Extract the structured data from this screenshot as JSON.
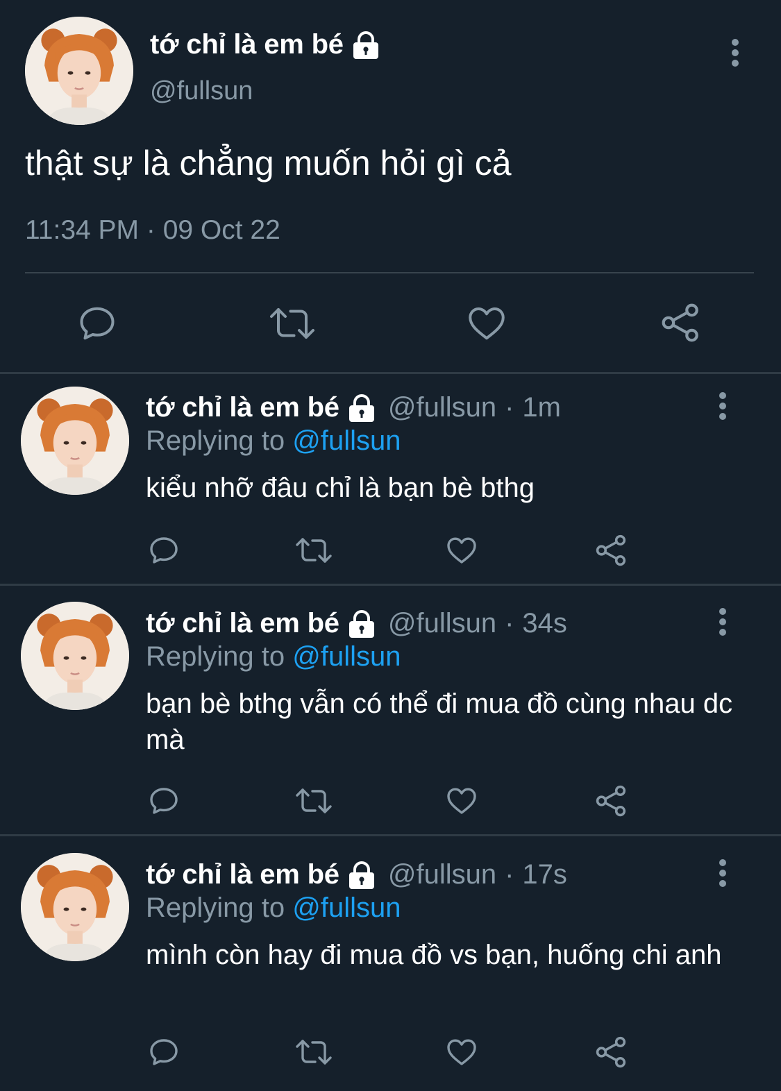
{
  "main_tweet": {
    "display_name": "tớ chỉ là em bé",
    "handle": "@fullsun",
    "text": "thật sự là chẳng muốn hỏi gì cả",
    "timestamp": "11:34 PM · 09 Oct 22",
    "icons": [
      "lock-icon",
      "more-icon",
      "reply-icon",
      "retweet-icon",
      "like-icon",
      "share-icon"
    ]
  },
  "replies": [
    {
      "display_name": "tớ chỉ là em bé",
      "handle": "@fullsun",
      "separator": "·",
      "time": "1m",
      "replying_prefix": "Replying to",
      "replying_mention": "@fullsun",
      "text": "kiểu nhỡ đâu chỉ là bạn bè bthg"
    },
    {
      "display_name": "tớ chỉ là em bé",
      "handle": "@fullsun",
      "separator": "·",
      "time": "34s",
      "replying_prefix": "Replying to",
      "replying_mention": "@fullsun",
      "text": "bạn bè bthg vẫn có thể đi mua đồ cùng nhau dc mà"
    },
    {
      "display_name": "tớ chỉ là em bé",
      "handle": "@fullsun",
      "separator": "·",
      "time": "17s",
      "replying_prefix": "Replying to",
      "replying_mention": "@fullsun",
      "text": "mình còn hay đi mua đồ vs bạn, huống chi anh"
    }
  ],
  "colors": {
    "background": "#15202b",
    "text": "#ffffff",
    "secondary_text": "#8899a6",
    "mention": "#1da1f2",
    "divider": "#38444d"
  }
}
